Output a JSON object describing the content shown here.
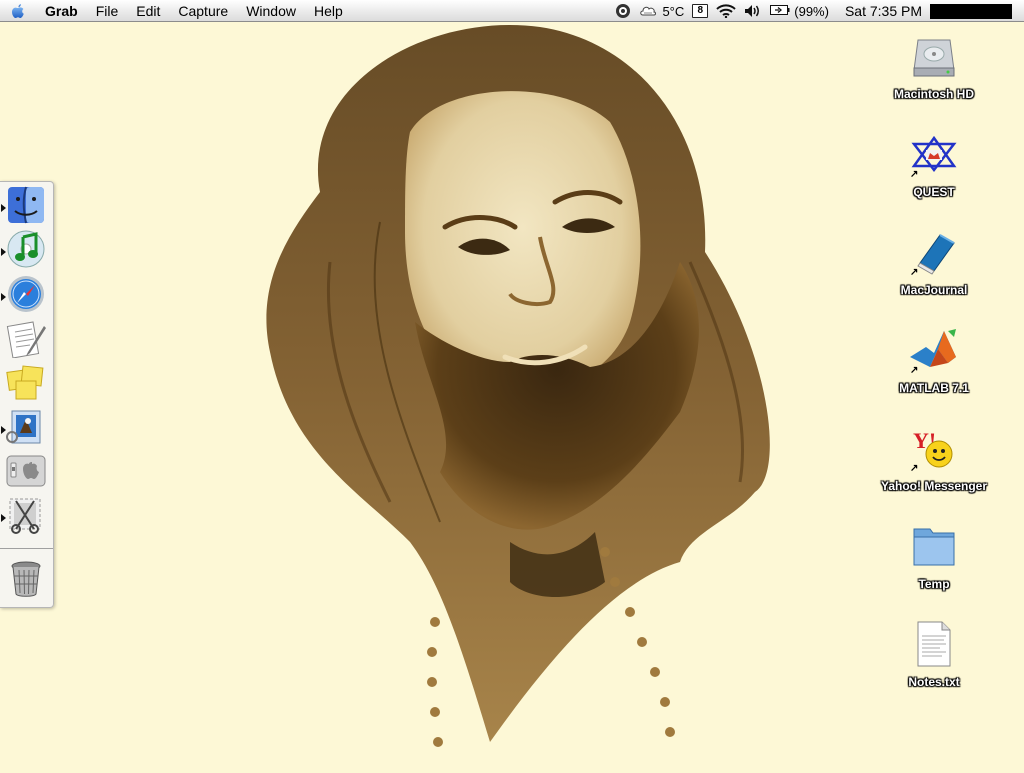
{
  "menubar": {
    "app_name": "Grab",
    "menus": [
      "File",
      "Edit",
      "Capture",
      "Window",
      "Help"
    ],
    "weather": "5°C",
    "calendar_day": "8",
    "battery": "(99%)",
    "clock": "Sat 7:35 PM"
  },
  "dock": {
    "items": [
      {
        "icon": "finder-icon",
        "running": true
      },
      {
        "icon": "itunes-icon",
        "running": true
      },
      {
        "icon": "safari-icon",
        "running": true
      },
      {
        "icon": "textedit-icon",
        "running": false
      },
      {
        "icon": "stickies-icon",
        "running": false
      },
      {
        "icon": "mail-icon",
        "running": true
      },
      {
        "icon": "system-preferences-icon",
        "running": false
      },
      {
        "icon": "grab-icon",
        "running": true
      }
    ],
    "trash": {
      "icon": "trash-icon"
    }
  },
  "desktop": {
    "icons": [
      {
        "label": "Macintosh HD",
        "icon": "hard-drive-icon",
        "alias": false
      },
      {
        "label": "QUEST",
        "icon": "quest-icon",
        "alias": true
      },
      {
        "label": "MacJournal",
        "icon": "macjournal-icon",
        "alias": true
      },
      {
        "label": "MATLAB 7.1",
        "icon": "matlab-icon",
        "alias": true
      },
      {
        "label": "Yahoo! Messenger",
        "icon": "yahoo-messenger-icon",
        "alias": true
      },
      {
        "label": "Temp",
        "icon": "folder-icon",
        "alias": false
      },
      {
        "label": "Notes.txt",
        "icon": "text-document-icon",
        "alias": false
      }
    ]
  },
  "colors": {
    "desktop_background": "#fdf8d6",
    "photo_tone": "#7a5a2a"
  }
}
